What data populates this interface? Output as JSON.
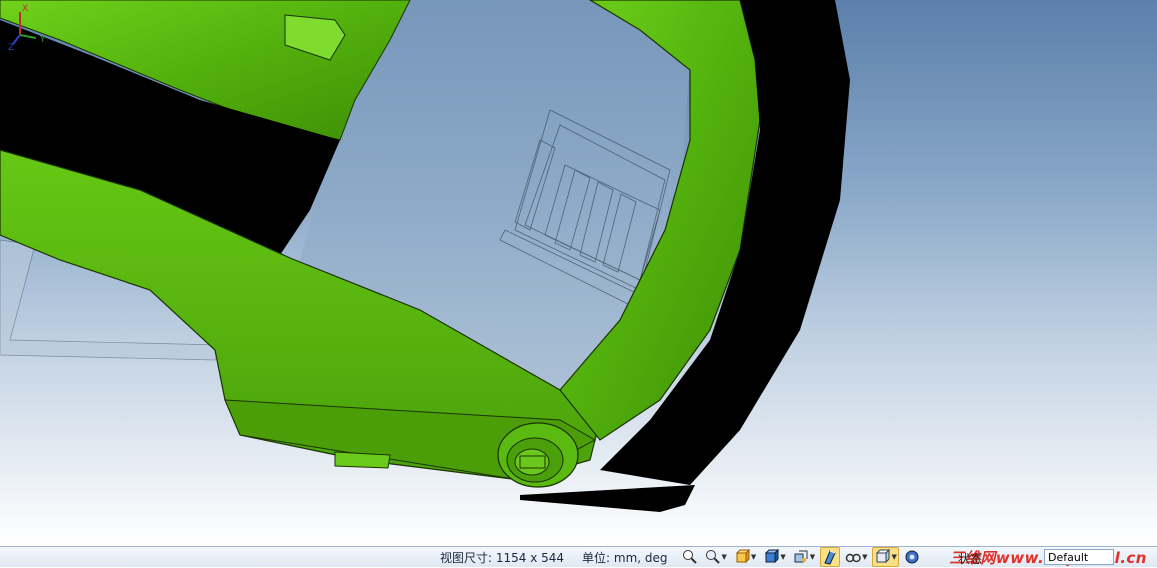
{
  "status_bar": {
    "view_size_text": "视图尺寸: 1154 x  544",
    "units_text": "单位: mm, deg",
    "status_label": "状态",
    "partial_label": "坐标",
    "display_mode": "Default"
  },
  "watermark": "三维网www.3dportal.cn",
  "triad": {
    "x_label": "X",
    "y_label": "Y",
    "z_label": "Z"
  },
  "toolbar_icons": [
    "zoom-fit-icon",
    "zoom-area-icon",
    "view-orientation-icon",
    "display-style-icon",
    "section-view-icon",
    "view-settings-icon",
    "hide-show-icon",
    "appearance-icon",
    "scene-icon",
    "options-icon"
  ],
  "colors": {
    "model_green": "#5dbb12",
    "background_top": "#5b80ab",
    "background_bottom": "#ffffff",
    "active_button": "#fbe08a"
  }
}
